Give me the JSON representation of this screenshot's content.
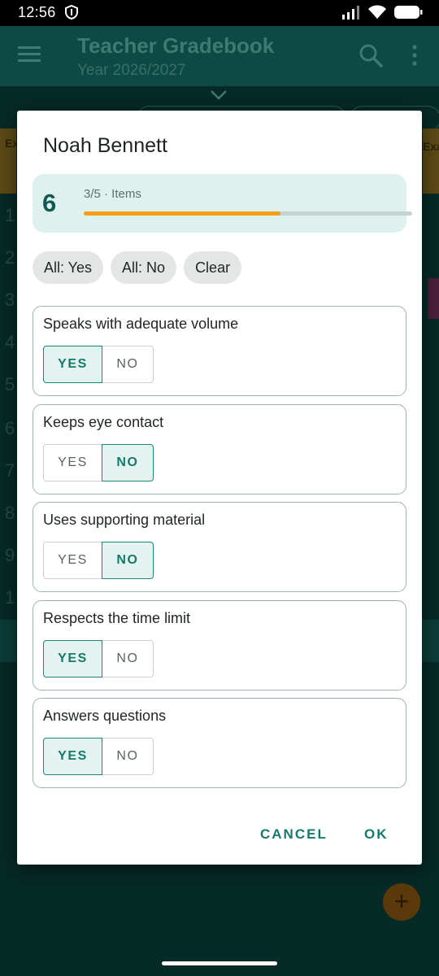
{
  "status_bar": {
    "time": "12:56",
    "icons": [
      "shield-icon",
      "signal-icon",
      "wifi-icon",
      "battery-icon"
    ]
  },
  "app_bar": {
    "title": "Teacher Gradebook",
    "subtitle": "Year 2026/2027",
    "icons": [
      "menu-icon",
      "search-icon",
      "more-vert-icon",
      "chevron-down-icon"
    ]
  },
  "background": {
    "left_header_text": "Ex",
    "right_header_text": "Exa",
    "row_numbers": [
      "1",
      "2",
      "3",
      "4",
      "5",
      "6",
      "7",
      "8",
      "9",
      "1"
    ],
    "fab_symbol": "+"
  },
  "dialog": {
    "title": "Noah Bennett",
    "score": {
      "value": "6",
      "caption": "3/5 · Items",
      "progress": 0.6
    },
    "quick_actions": [
      {
        "label": "All: Yes"
      },
      {
        "label": "All: No"
      },
      {
        "label": "Clear"
      }
    ],
    "yes_label": "YES",
    "no_label": "NO",
    "items": [
      {
        "label": "Speaks with adequate volume",
        "answer": "yes"
      },
      {
        "label": "Keeps eye contact",
        "answer": "no"
      },
      {
        "label": "Uses supporting material",
        "answer": "no"
      },
      {
        "label": "Respects the time limit",
        "answer": "yes"
      },
      {
        "label": "Answers questions",
        "answer": "yes"
      }
    ],
    "cancel_label": "CANCEL",
    "ok_label": "OK"
  },
  "colors": {
    "accent": "#16796c",
    "progress": "#f29d13",
    "score_card_bg": "#dff1ee"
  }
}
